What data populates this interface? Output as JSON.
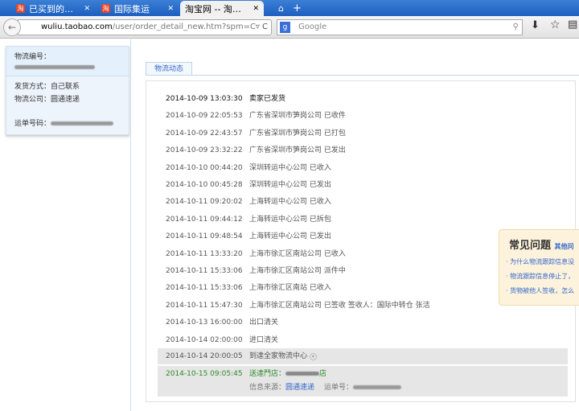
{
  "browser": {
    "tabs": [
      {
        "label": "已买到的…",
        "icon": "taobao-icon"
      },
      {
        "label": "国际集运",
        "icon": "taobao-icon"
      },
      {
        "label": "淘宝网 -- 淘…",
        "active": true
      }
    ],
    "url_domain": "wuliu.taobao.com",
    "url_path": "/user/order_detail_new.htm?spm=C",
    "search_placeholder": "Google"
  },
  "left": {
    "tracking_label": "物流编号：",
    "ship_method": "发货方式：自己联系",
    "company": "物流公司：圆通速递",
    "waybill_label": "运单号码："
  },
  "tab_label": "物流动态",
  "events": [
    {
      "time": "2014-10-09 13:03:30",
      "desc": "卖家已发货"
    },
    {
      "time": "2014-10-09 22:05:53",
      "desc": "广东省深圳市笋岗公司 已收件"
    },
    {
      "time": "2014-10-09 22:43:57",
      "desc": "广东省深圳市笋岗公司 已打包"
    },
    {
      "time": "2014-10-09 23:32:22",
      "desc": "广东省深圳市笋岗公司 已发出"
    },
    {
      "time": "2014-10-10 00:44:20",
      "desc": "深圳转运中心公司 已收入"
    },
    {
      "time": "2014-10-10 00:45:28",
      "desc": "深圳转运中心公司 已发出"
    },
    {
      "time": "2014-10-11 09:20:02",
      "desc": "上海转运中心公司 已收入"
    },
    {
      "time": "2014-10-11 09:44:12",
      "desc": "上海转运中心公司 已拆包"
    },
    {
      "time": "2014-10-11 09:48:54",
      "desc": "上海转运中心公司 已发出"
    },
    {
      "time": "2014-10-11 13:33:20",
      "desc": "上海市徐汇区南站公司 已收入"
    },
    {
      "time": "2014-10-11 15:33:06",
      "desc": "上海市徐汇区南站公司 派件中"
    },
    {
      "time": "2014-10-11 15:33:06",
      "desc": "上海市徐汇区南站 已收入"
    },
    {
      "time": "2014-10-11 15:47:30",
      "desc": "上海市徐汇区南站公司 已签收 签收人：国际中转仓 张洁"
    },
    {
      "time": "2014-10-13 16:00:00",
      "desc": "出口清关"
    },
    {
      "time": "2014-10-14 02:00:00",
      "desc": "进口清关"
    },
    {
      "time": "2014-10-14 20:00:05",
      "desc": "到達全家物流中心"
    },
    {
      "time": "2014-10-15 09:05:45",
      "desc": "送達門店：",
      "desc_suffix": "店"
    }
  ],
  "source": {
    "label": "信息来源：",
    "company": "圆通速递",
    "waybill_label": "运单号："
  },
  "faq": {
    "title": "常见问题",
    "more": "其他问",
    "items": [
      "为什么物流跟踪信息没",
      "物流跟踪信息停止了，",
      "货物被他人签收，怎么"
    ]
  }
}
